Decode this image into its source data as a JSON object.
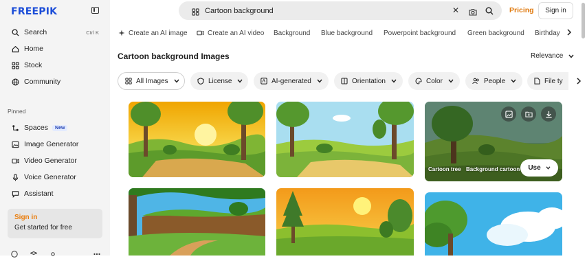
{
  "sidebar": {
    "logo": "FREEPIK",
    "search_label": "Search",
    "search_shortcut": "Ctrl K",
    "nav": [
      {
        "label": "Home",
        "icon": "home-icon"
      },
      {
        "label": "Stock",
        "icon": "stock-icon"
      },
      {
        "label": "Community",
        "icon": "globe-icon"
      }
    ],
    "pinned_label": "Pinned",
    "pinned": [
      {
        "label": "Spaces",
        "icon": "spaces-icon",
        "badge": "New"
      },
      {
        "label": "Image Generator",
        "icon": "image-icon"
      },
      {
        "label": "Video Generator",
        "icon": "video-icon"
      },
      {
        "label": "Voice Generator",
        "icon": "voice-icon"
      },
      {
        "label": "Assistant",
        "icon": "assistant-icon"
      }
    ],
    "signin_card": {
      "title": "Sign in",
      "subtitle": "Get started for free"
    }
  },
  "header": {
    "search_value": "Cartoon background",
    "pricing": "Pricing",
    "sign_in": "Sign in"
  },
  "suggestions": [
    "Create an AI image",
    "Create an AI video",
    "Background",
    "Blue background",
    "Powerpoint background",
    "Green background",
    "Birthday"
  ],
  "results": {
    "title": "Cartoon background Images",
    "sort": "Relevance"
  },
  "filters": [
    "All Images",
    "License",
    "AI-generated",
    "Orientation",
    "Color",
    "People",
    "File ty"
  ],
  "card": {
    "tags": [
      "Cartoon tree",
      "Background cartoon"
    ],
    "use_label": "Use"
  },
  "colors": {
    "brand": "#1d4ed8",
    "accent": "#e0790d"
  }
}
